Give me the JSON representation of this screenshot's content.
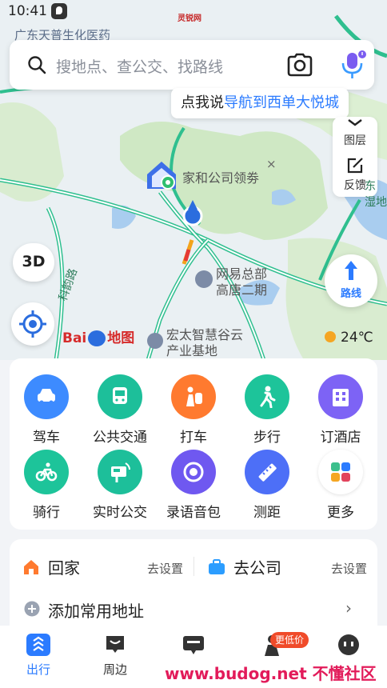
{
  "status_bar": {
    "time": "10:41"
  },
  "top_watermark": "灵锐网",
  "map": {
    "poi_top": "广东天普生化医药",
    "poi_home_company": "家和公司领劵",
    "poi_netease": [
      "网易总部",
      "高唐二期"
    ],
    "poi_hongtai": [
      "宏太智慧谷云",
      "产业基地"
    ],
    "road_label": "科韵路",
    "right_label": [
      "东",
      "湿地"
    ],
    "baidu_logo": {
      "text_left": "Bai",
      "text_right": "地图"
    },
    "weather": "24℃"
  },
  "search": {
    "placeholder": "搜地点、查公交、找路线"
  },
  "tooltip": {
    "prefix": "点我说",
    "highlight": "导航到西单大悦城"
  },
  "side_panel": {
    "layers": "图层",
    "feedback": "反馈"
  },
  "map_controls": {
    "three_d": "3D",
    "route": "路线"
  },
  "tools": [
    {
      "label": "驾车",
      "icon": "car-icon",
      "color": "#3d8bff"
    },
    {
      "label": "公共交通",
      "icon": "bus-icon",
      "color": "#1dbf9a"
    },
    {
      "label": "打车",
      "icon": "taxi-icon",
      "color": "#ff7a2f"
    },
    {
      "label": "步行",
      "icon": "walk-icon",
      "color": "#1dc49a"
    },
    {
      "label": "订酒店",
      "icon": "hotel-icon",
      "color": "#7d63f5"
    },
    {
      "label": "骑行",
      "icon": "bike-icon",
      "color": "#1dc49a"
    },
    {
      "label": "实时公交",
      "icon": "realtime-bus-icon",
      "color": "#1dbf9a"
    },
    {
      "label": "录语音包",
      "icon": "voice-pack-icon",
      "color": "#6f58f0"
    },
    {
      "label": "测距",
      "icon": "ruler-icon",
      "color": "#4d6ff7"
    },
    {
      "label": "更多",
      "icon": "more-icon",
      "color": "#ffffff"
    }
  ],
  "addresses": {
    "home": {
      "title": "回家",
      "action": "去设置"
    },
    "company": {
      "title": "去公司",
      "action": "去设置"
    },
    "add_common": "添加常用地址"
  },
  "tabs": [
    {
      "label": "出行",
      "active": true
    },
    {
      "label": "周边",
      "active": false
    },
    {
      "label": "",
      "active": false
    },
    {
      "label": "",
      "active": false
    },
    {
      "label": "",
      "active": false
    }
  ],
  "tab_badge": "更低价",
  "bottom_watermark": "www.budog.net 不懂社区",
  "colors": {
    "accent": "#2b7bff",
    "road": "#2fbf8f",
    "park": "#cfe8c4",
    "water": "#a9cdef"
  }
}
